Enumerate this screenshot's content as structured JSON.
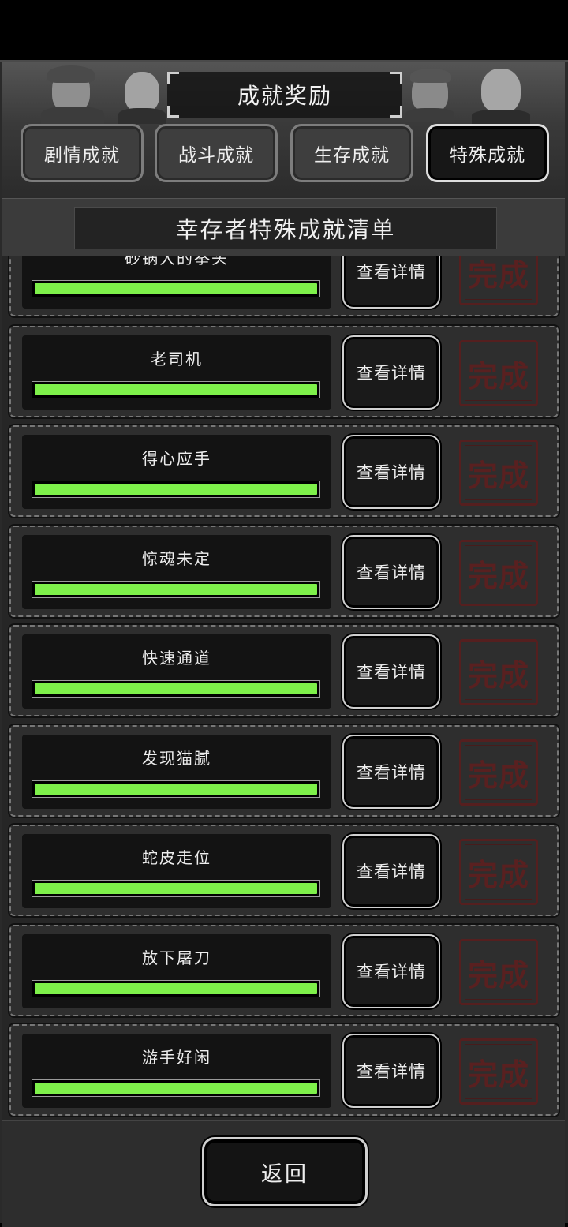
{
  "header": {
    "title": "成就奖励"
  },
  "tabs": [
    {
      "label": "剧情成就",
      "active": false
    },
    {
      "label": "战斗成就",
      "active": false
    },
    {
      "label": "生存成就",
      "active": false
    },
    {
      "label": "特殊成就",
      "active": true
    }
  ],
  "subtitle": "幸存者特殊成就清单",
  "achievements": [
    {
      "name": "砂锅大的拳头",
      "progress": 1.0,
      "detail_label": "查看详情",
      "status": "完成"
    },
    {
      "name": "老司机",
      "progress": 1.0,
      "detail_label": "查看详情",
      "status": "完成"
    },
    {
      "name": "得心应手",
      "progress": 1.0,
      "detail_label": "查看详情",
      "status": "完成"
    },
    {
      "name": "惊魂未定",
      "progress": 1.0,
      "detail_label": "查看详情",
      "status": "完成"
    },
    {
      "name": "快速通道",
      "progress": 1.0,
      "detail_label": "查看详情",
      "status": "完成"
    },
    {
      "name": "发现猫腻",
      "progress": 1.0,
      "detail_label": "查看详情",
      "status": "完成"
    },
    {
      "name": "蛇皮走位",
      "progress": 1.0,
      "detail_label": "查看详情",
      "status": "完成"
    },
    {
      "name": "放下屠刀",
      "progress": 1.0,
      "detail_label": "查看详情",
      "status": "完成"
    },
    {
      "name": "游手好闲",
      "progress": 1.0,
      "detail_label": "查看详情",
      "status": "完成"
    }
  ],
  "footer": {
    "back_label": "返回"
  },
  "colors": {
    "progress_fill": "#7ef04a",
    "stamp_red": "#5e1f1f"
  }
}
